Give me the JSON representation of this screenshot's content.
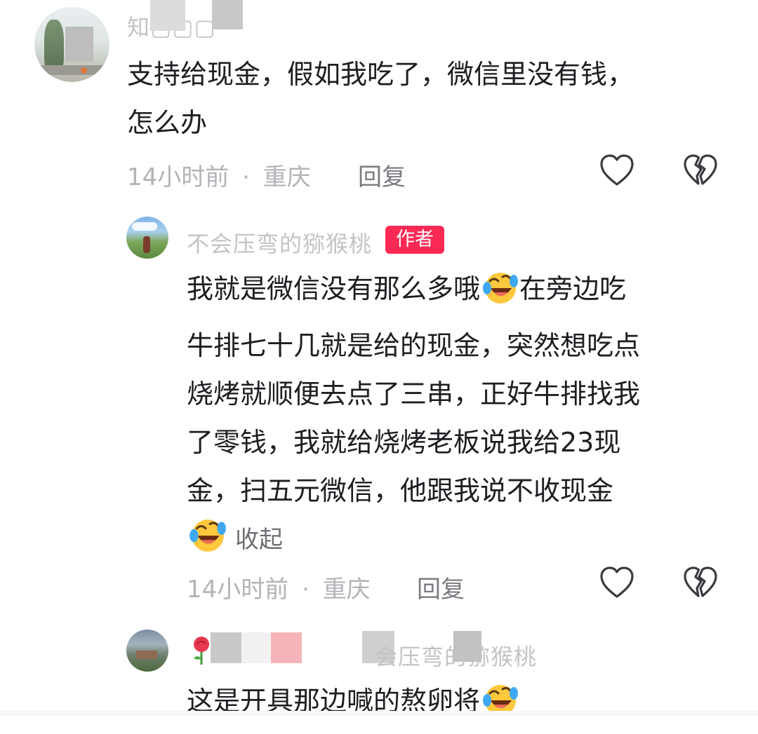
{
  "colors": {
    "author_badge_bg": "#fa2a55",
    "meta_text": "#b3b3b8",
    "body_text": "#1d1d22",
    "username_text": "#c4c4c8"
  },
  "comments": [
    {
      "username": "知▢▢▢",
      "text_lines": [
        "支持给现金，假如我吃了，微信里没有钱，",
        "怎么办"
      ],
      "time": "14小时前",
      "location": "重庆",
      "reply_label": "回复",
      "like_icon": "heart-outline-icon",
      "dislike_icon": "broken-heart-outline-icon"
    },
    {
      "username": "不会压弯的猕猴桃",
      "badge": "作者",
      "text_lines": [
        "我就是微信没有那么多哦",
        "在旁边吃",
        "牛排七十几就是给的现金，突然想吃点",
        "烧烤就顺便去点了三串，正好牛排找我",
        "了零钱，我就给烧烤老板说我给23现",
        "金，扫五元微信，他跟我说不收现金"
      ],
      "emoji_icon": "rolling-laughing-emoji-icon",
      "collapse_label": "收起",
      "time": "14小时前",
      "location": "重庆",
      "reply_label": "回复",
      "like_icon": "heart-outline-icon",
      "dislike_icon": "broken-heart-outline-icon"
    },
    {
      "username_prefix_icon": "rose-emoji-icon",
      "username": "会压弯的猕猴桃",
      "text_line": "这是开具那边喊的熬卵将"
    }
  ],
  "separator": "·"
}
